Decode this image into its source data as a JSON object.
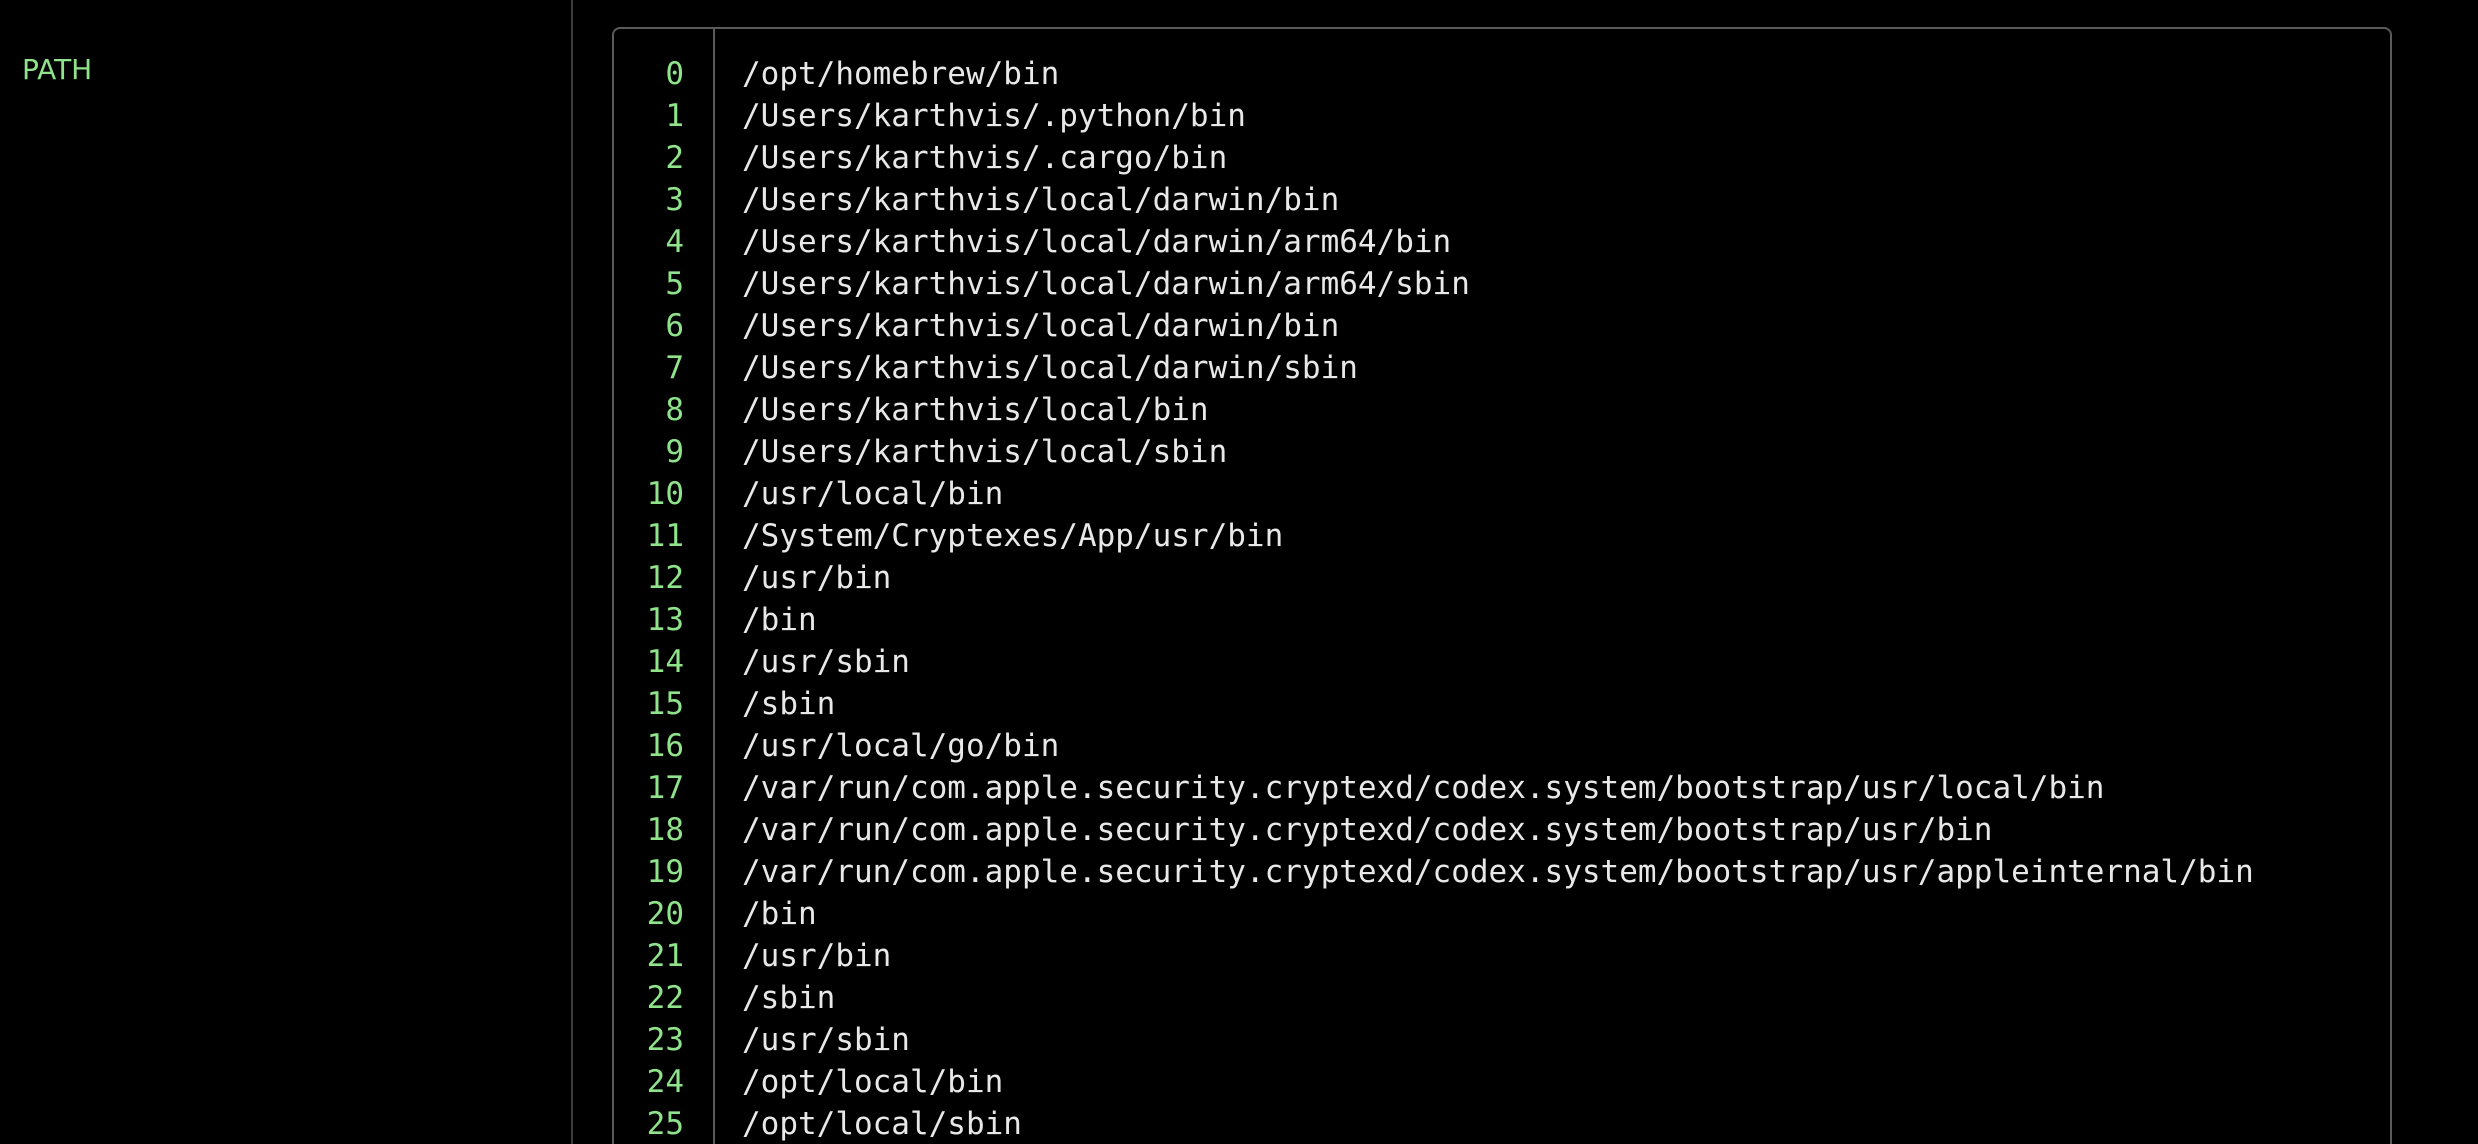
{
  "variable": {
    "name": "PATH"
  },
  "colors": {
    "background": "#000000",
    "index": "#8fe38a",
    "text": "#e8e8e8",
    "border": "#5a5a5a"
  },
  "entries": [
    {
      "index": "0",
      "value": "/opt/homebrew/bin"
    },
    {
      "index": "1",
      "value": "/Users/karthvis/.python/bin"
    },
    {
      "index": "2",
      "value": "/Users/karthvis/.cargo/bin"
    },
    {
      "index": "3",
      "value": "/Users/karthvis/local/darwin/bin"
    },
    {
      "index": "4",
      "value": "/Users/karthvis/local/darwin/arm64/bin"
    },
    {
      "index": "5",
      "value": "/Users/karthvis/local/darwin/arm64/sbin"
    },
    {
      "index": "6",
      "value": "/Users/karthvis/local/darwin/bin"
    },
    {
      "index": "7",
      "value": "/Users/karthvis/local/darwin/sbin"
    },
    {
      "index": "8",
      "value": "/Users/karthvis/local/bin"
    },
    {
      "index": "9",
      "value": "/Users/karthvis/local/sbin"
    },
    {
      "index": "10",
      "value": "/usr/local/bin"
    },
    {
      "index": "11",
      "value": "/System/Cryptexes/App/usr/bin"
    },
    {
      "index": "12",
      "value": "/usr/bin"
    },
    {
      "index": "13",
      "value": "/bin"
    },
    {
      "index": "14",
      "value": "/usr/sbin"
    },
    {
      "index": "15",
      "value": "/sbin"
    },
    {
      "index": "16",
      "value": "/usr/local/go/bin"
    },
    {
      "index": "17",
      "value": "/var/run/com.apple.security.cryptexd/codex.system/bootstrap/usr/local/bin"
    },
    {
      "index": "18",
      "value": "/var/run/com.apple.security.cryptexd/codex.system/bootstrap/usr/bin"
    },
    {
      "index": "19",
      "value": "/var/run/com.apple.security.cryptexd/codex.system/bootstrap/usr/appleinternal/bin"
    },
    {
      "index": "20",
      "value": "/bin"
    },
    {
      "index": "21",
      "value": "/usr/bin"
    },
    {
      "index": "22",
      "value": "/sbin"
    },
    {
      "index": "23",
      "value": "/usr/sbin"
    },
    {
      "index": "24",
      "value": "/opt/local/bin"
    },
    {
      "index": "25",
      "value": "/opt/local/sbin"
    }
  ]
}
